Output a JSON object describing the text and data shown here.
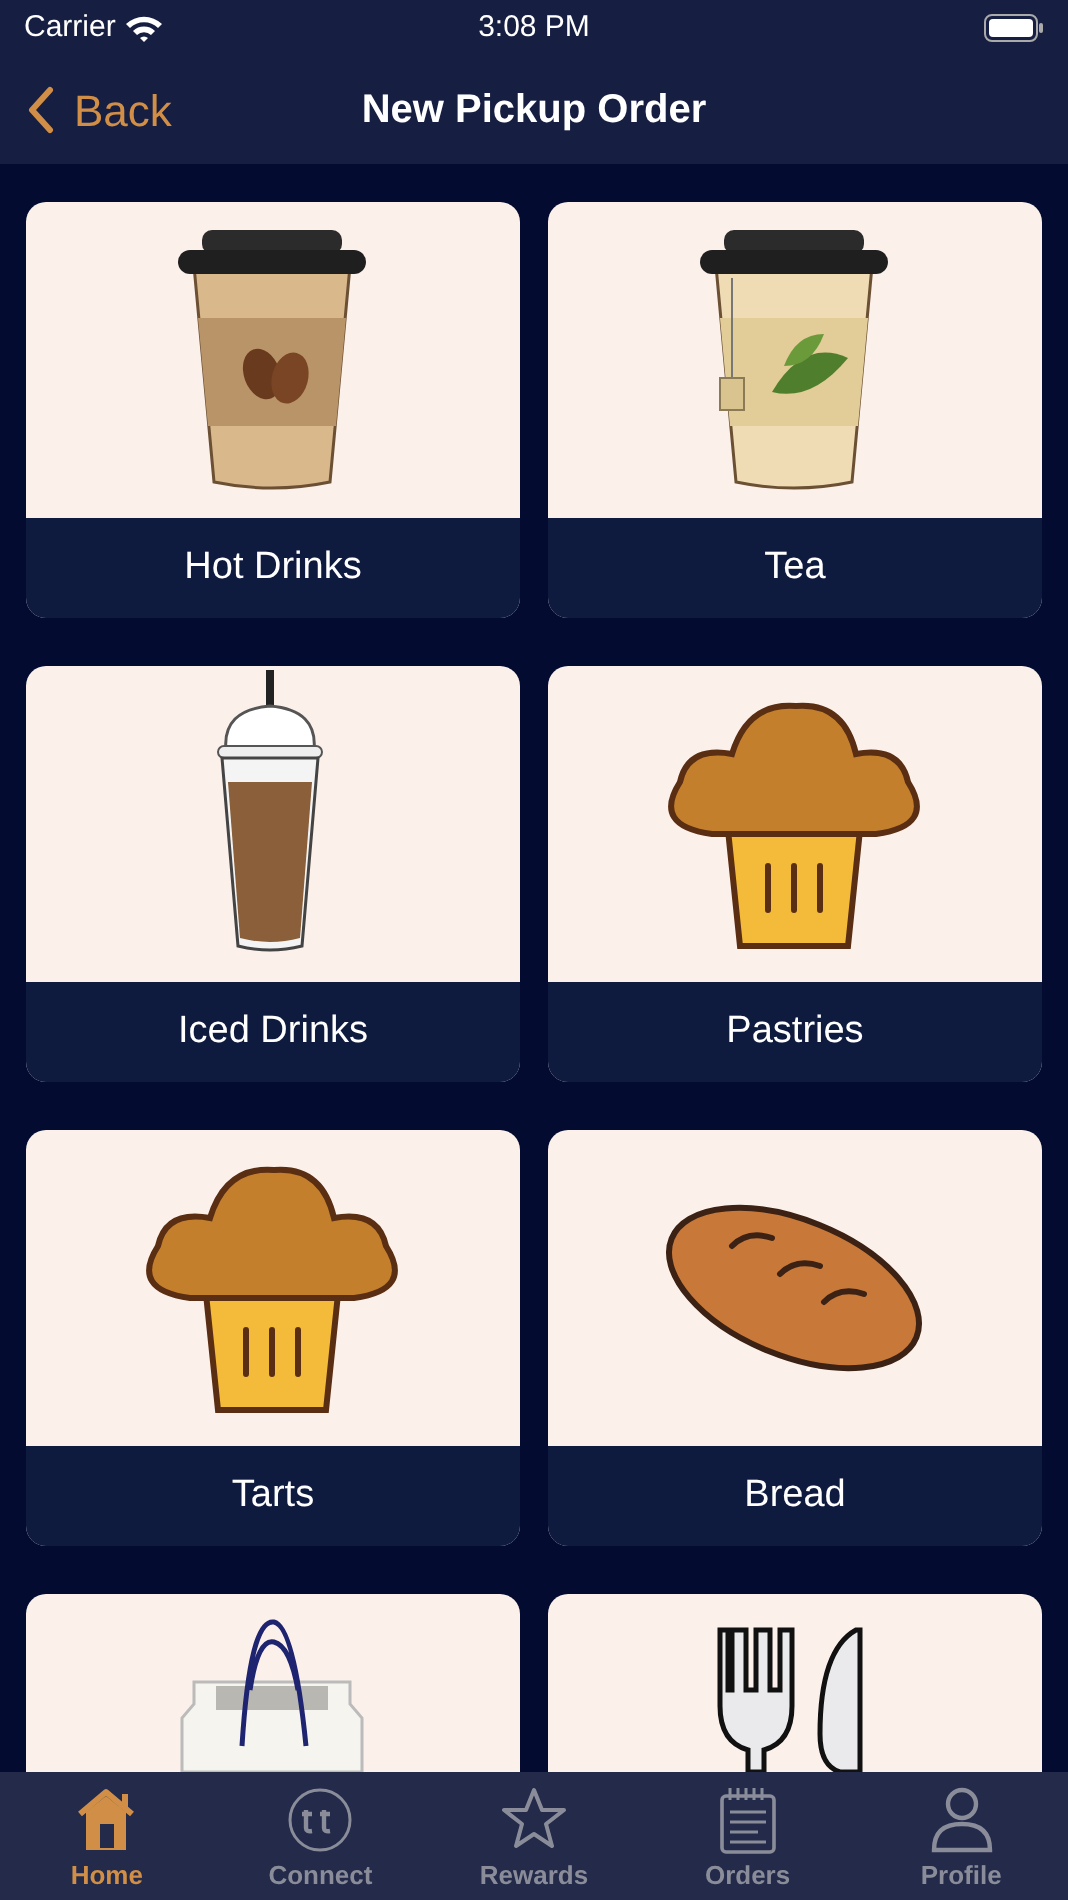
{
  "status_bar": {
    "carrier": "Carrier",
    "time": "3:08 PM"
  },
  "nav_bar": {
    "back": "Back",
    "title": "New Pickup Order"
  },
  "categories": [
    {
      "kind": "labeled",
      "label": "Hot Drinks"
    },
    {
      "kind": "labeled",
      "label": "Tea"
    },
    {
      "kind": "labeled",
      "label": "Iced Drinks"
    },
    {
      "kind": "labeled",
      "label": "Pastries"
    },
    {
      "kind": "labeled",
      "label": "Tarts"
    },
    {
      "kind": "labeled",
      "label": "Bread"
    },
    {
      "kind": "image-only"
    },
    {
      "kind": "image-only"
    }
  ],
  "tab_bar": [
    {
      "label": "Home",
      "selected": true
    },
    {
      "label": "Connect",
      "selected": false
    },
    {
      "label": "Rewards",
      "selected": false
    },
    {
      "label": "Orders",
      "selected": false
    },
    {
      "label": "Profile",
      "selected": false
    }
  ]
}
